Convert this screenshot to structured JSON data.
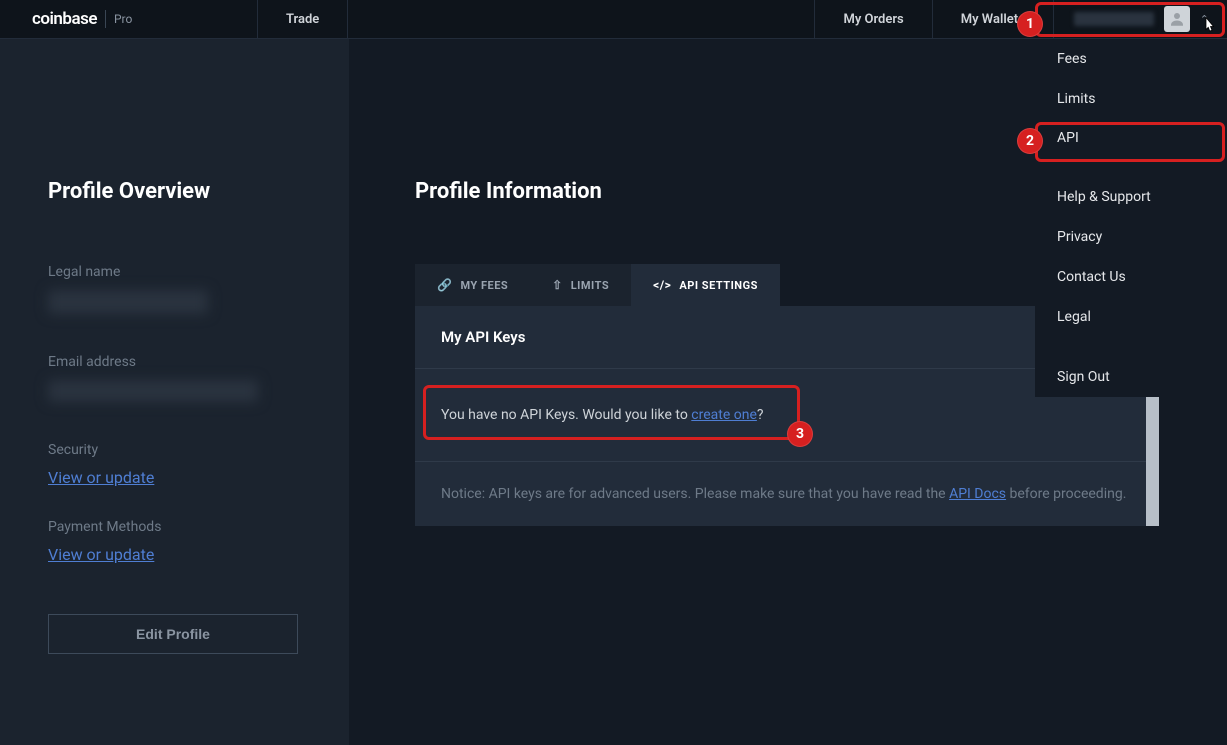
{
  "brand": {
    "main": "coinbase",
    "sub": "Pro"
  },
  "nav": {
    "trade": "Trade",
    "my_orders": "My Orders",
    "my_wallets": "My Wallets"
  },
  "dropdown": {
    "fees": "Fees",
    "limits": "Limits",
    "api": "API",
    "help": "Help & Support",
    "privacy": "Privacy",
    "contact": "Contact Us",
    "legal": "Legal",
    "signout": "Sign Out"
  },
  "sidebar": {
    "title": "Profile Overview",
    "legal_name_label": "Legal name",
    "email_label": "Email address",
    "security_label": "Security",
    "security_link": "View or update",
    "payment_label": "Payment Methods",
    "payment_link": "View or update",
    "edit_btn": "Edit Profile"
  },
  "main": {
    "title": "Profile Information",
    "tabs": {
      "fees": "MY FEES",
      "limits": "LIMITS",
      "api": "API SETTINGS"
    },
    "api_keys_heading": "My API Keys",
    "new_api_glyph": "+",
    "no_keys_1": "You have no API Keys. Would you like to ",
    "no_keys_link": "create one",
    "no_keys_2": "?",
    "notice_1": "Notice: API keys are for advanced users. Please make sure that you have read the ",
    "notice_link": "API Docs",
    "notice_2": " before proceeding."
  },
  "annotations": {
    "b1": "1",
    "b2": "2",
    "b3": "3"
  }
}
